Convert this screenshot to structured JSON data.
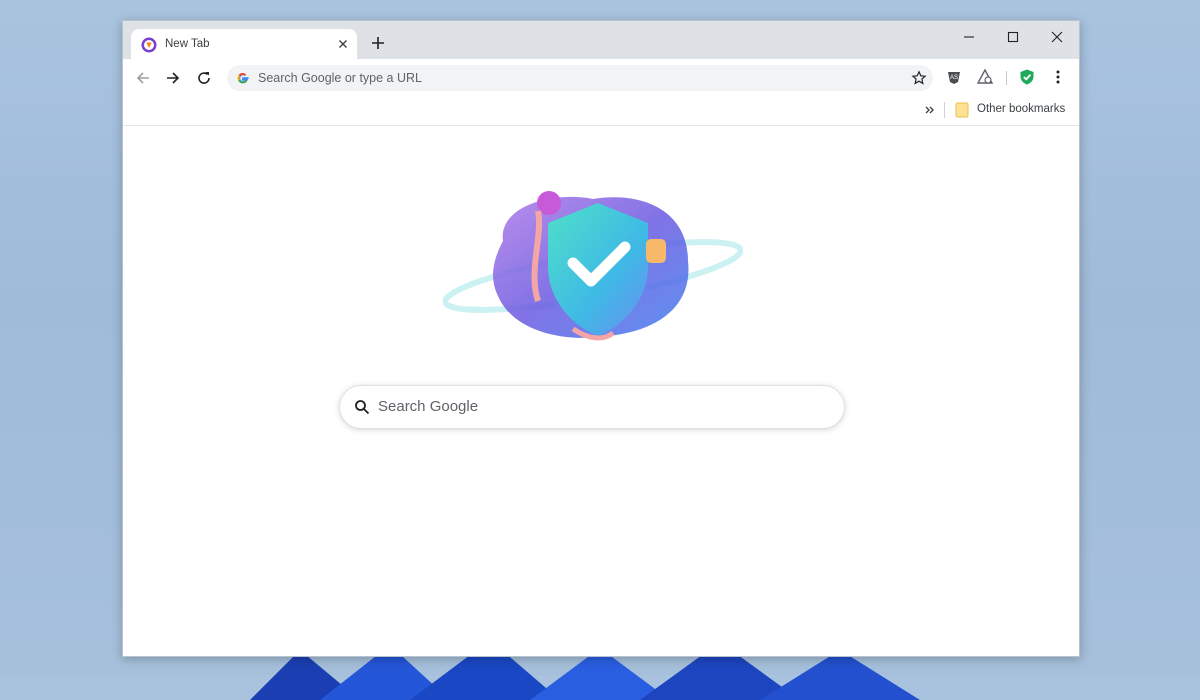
{
  "tab": {
    "title": "New Tab",
    "favicon": "avast-secure-browser-icon"
  },
  "window_controls": {
    "minimize": "minimize-icon",
    "maximize": "maximize-icon",
    "close": "close-icon"
  },
  "toolbar": {
    "omnibox_placeholder": "Search Google or type a URL",
    "extensions": [
      "privacy-extension-icon",
      "avast-extension-icon",
      "shield-check-extension-icon"
    ]
  },
  "bookmarks": {
    "other_label": "Other bookmarks"
  },
  "page": {
    "search_placeholder": "Search Google"
  },
  "colors": {
    "accent_green": "#1faa59",
    "hero_teal": "#3fd1c0",
    "hero_purple": "#7b4fd6"
  }
}
